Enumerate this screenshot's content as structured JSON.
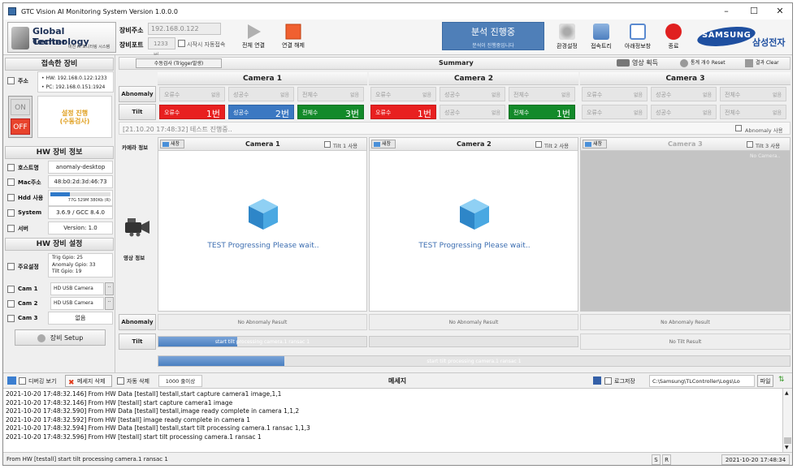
{
  "window": {
    "title": "GTC Vision AI Monitoring System Version 1.0.0.0"
  },
  "logo": {
    "line1": "Global Technology",
    "line2": "Center",
    "sub": "비전 AI 모니터링 시스템"
  },
  "connection": {
    "ip_label": "장비주소",
    "ip_value": "192.168.0.122",
    "port_label": "장비포트",
    "port_value": "1233 번",
    "autostart_label": "시작시 자동접속",
    "connect_label": "전체 연결",
    "disconnect_label": "연결 해제"
  },
  "status": {
    "main": "분석 진행중",
    "sub": "분석이 진행중입니다"
  },
  "toolbar": {
    "settings": "환경설정",
    "tree": "접속트리",
    "below": "아래정보창",
    "exit": "종료"
  },
  "brand": {
    "logo": "SAMSUNG",
    "name": "삼성전자"
  },
  "left": {
    "connected_title": "접속한 장비",
    "addr_label": "주소",
    "addr_lines": [
      "• HW: 192.168.0.122:1233",
      "• PC: 192.168.0.151:1924"
    ],
    "on": "ON",
    "off": "OFF",
    "setting_line1": "설정 진행",
    "setting_line2": "(수동검사)",
    "hw_info_title": "HW 장비 정보",
    "host_label": "호스트명",
    "host_value": "anomaly-desktop",
    "mac_label": "Mac주소",
    "mac_value": "48:b0:2d:3d:46:73",
    "hdd_label": "Hdd 사용",
    "hdd_value": "77G 529M 380Kb (R)",
    "hdd_usage": 0.32,
    "system_label": "System",
    "system_value": "3.6.9 / GCC 8.4.0",
    "server_label": "서버",
    "server_value": "Version: 1.0",
    "hw_set_title": "HW 장비 설정",
    "main_label": "주요설정",
    "main_lines": [
      "Trig Gpio: 25",
      "Anomaly Gpio: 33",
      "Tilt Gpio: 19"
    ],
    "cam1_label": "Cam 1",
    "cam1_value": "HD USB Camera",
    "cam2_label": "Cam 2",
    "cam2_value": "HD USB Camera",
    "cam3_label": "Cam 3",
    "cam3_value": "없음",
    "setup_label": "장비 Setup",
    "more": ".."
  },
  "summary_bar": {
    "manual": "수동검사 (Trigger발생)",
    "title": "Summary",
    "capture": "영상 획득",
    "reset": "통계 개수 Reset",
    "clear": "결과 Clear"
  },
  "cameras": [
    {
      "name": "Camera 1",
      "tilt_use": "Tilt 1 사용",
      "progress": "TEST Progressing Please wait..",
      "anomaly_result": "No Abnomaly Result",
      "tilt_result": "start tilt processing camera.1 ransac 1",
      "tilt_fill": 0.38
    },
    {
      "name": "Camera 2",
      "tilt_use": "Tilt 2 사용",
      "progress": "TEST Progressing Please wait..",
      "anomaly_result": "No Abnomaly Result",
      "tilt_result": "",
      "tilt_fill": 0.0
    },
    {
      "name": "Camera 3",
      "tilt_use": "Tilt 3 사용",
      "progress": "No Camera..",
      "anomaly_result": "No Abnomaly Result",
      "tilt_result": "No Tilt Result",
      "tilt_fill": 0.0
    }
  ],
  "stats": {
    "row_abnomaly": "Abnomaly",
    "row_tilt": "Tilt",
    "error": "오류수",
    "success": "성공수",
    "total": "전체수",
    "unit": "없음",
    "tilt_c1": [
      "1번",
      "2번",
      "3번"
    ],
    "tilt_c2": [
      "1번",
      "",
      "1번"
    ]
  },
  "info": {
    "test_line": "[21.10.20 17:48:32] 테스트 진행중..",
    "abnomaly_use": "Abnomaly 사용",
    "cam_info": "카메라 정보",
    "video_info": "영상 정보",
    "new": "새창"
  },
  "overall_progress": {
    "text": "start tilt processing camera.1 ransac 1",
    "fill": 0.2
  },
  "log": {
    "debug": "디버깅 보기",
    "delete": "메세지 삭제",
    "autodel": "자동 삭제",
    "lines_value": "1000 줄이상",
    "title": "메세지",
    "logsave": "로그저장",
    "path": "C:\\Samsung\\TLController\\Logs\\Lo",
    "file": "파일",
    "entries": [
      "2021-10-20 17:48:32.146] From HW Data [testall] testall,start capture camera1 image,1,1",
      "2021-10-20 17:48:32.146] From HW [testall] start capture camera1 image",
      "2021-10-20 17:48:32.590] From HW Data [testall] testall,image ready complete in camera 1,1,2",
      "2021-10-20 17:48:32.592] From HW [testall] image ready complete in camera 1",
      "2021-10-20 17:48:32.594] From HW Data [testall] testall,start tilt processing camera.1 ransac 1,1,3",
      "2021-10-20 17:48:32.596] From HW [testall] start tilt processing camera.1 ransac 1"
    ]
  },
  "statusbar": {
    "msg": "From HW [testall] start tilt processing camera.1 ransac 1",
    "s": "S",
    "r": "R",
    "time": "2021-10-20 17:48:34"
  }
}
